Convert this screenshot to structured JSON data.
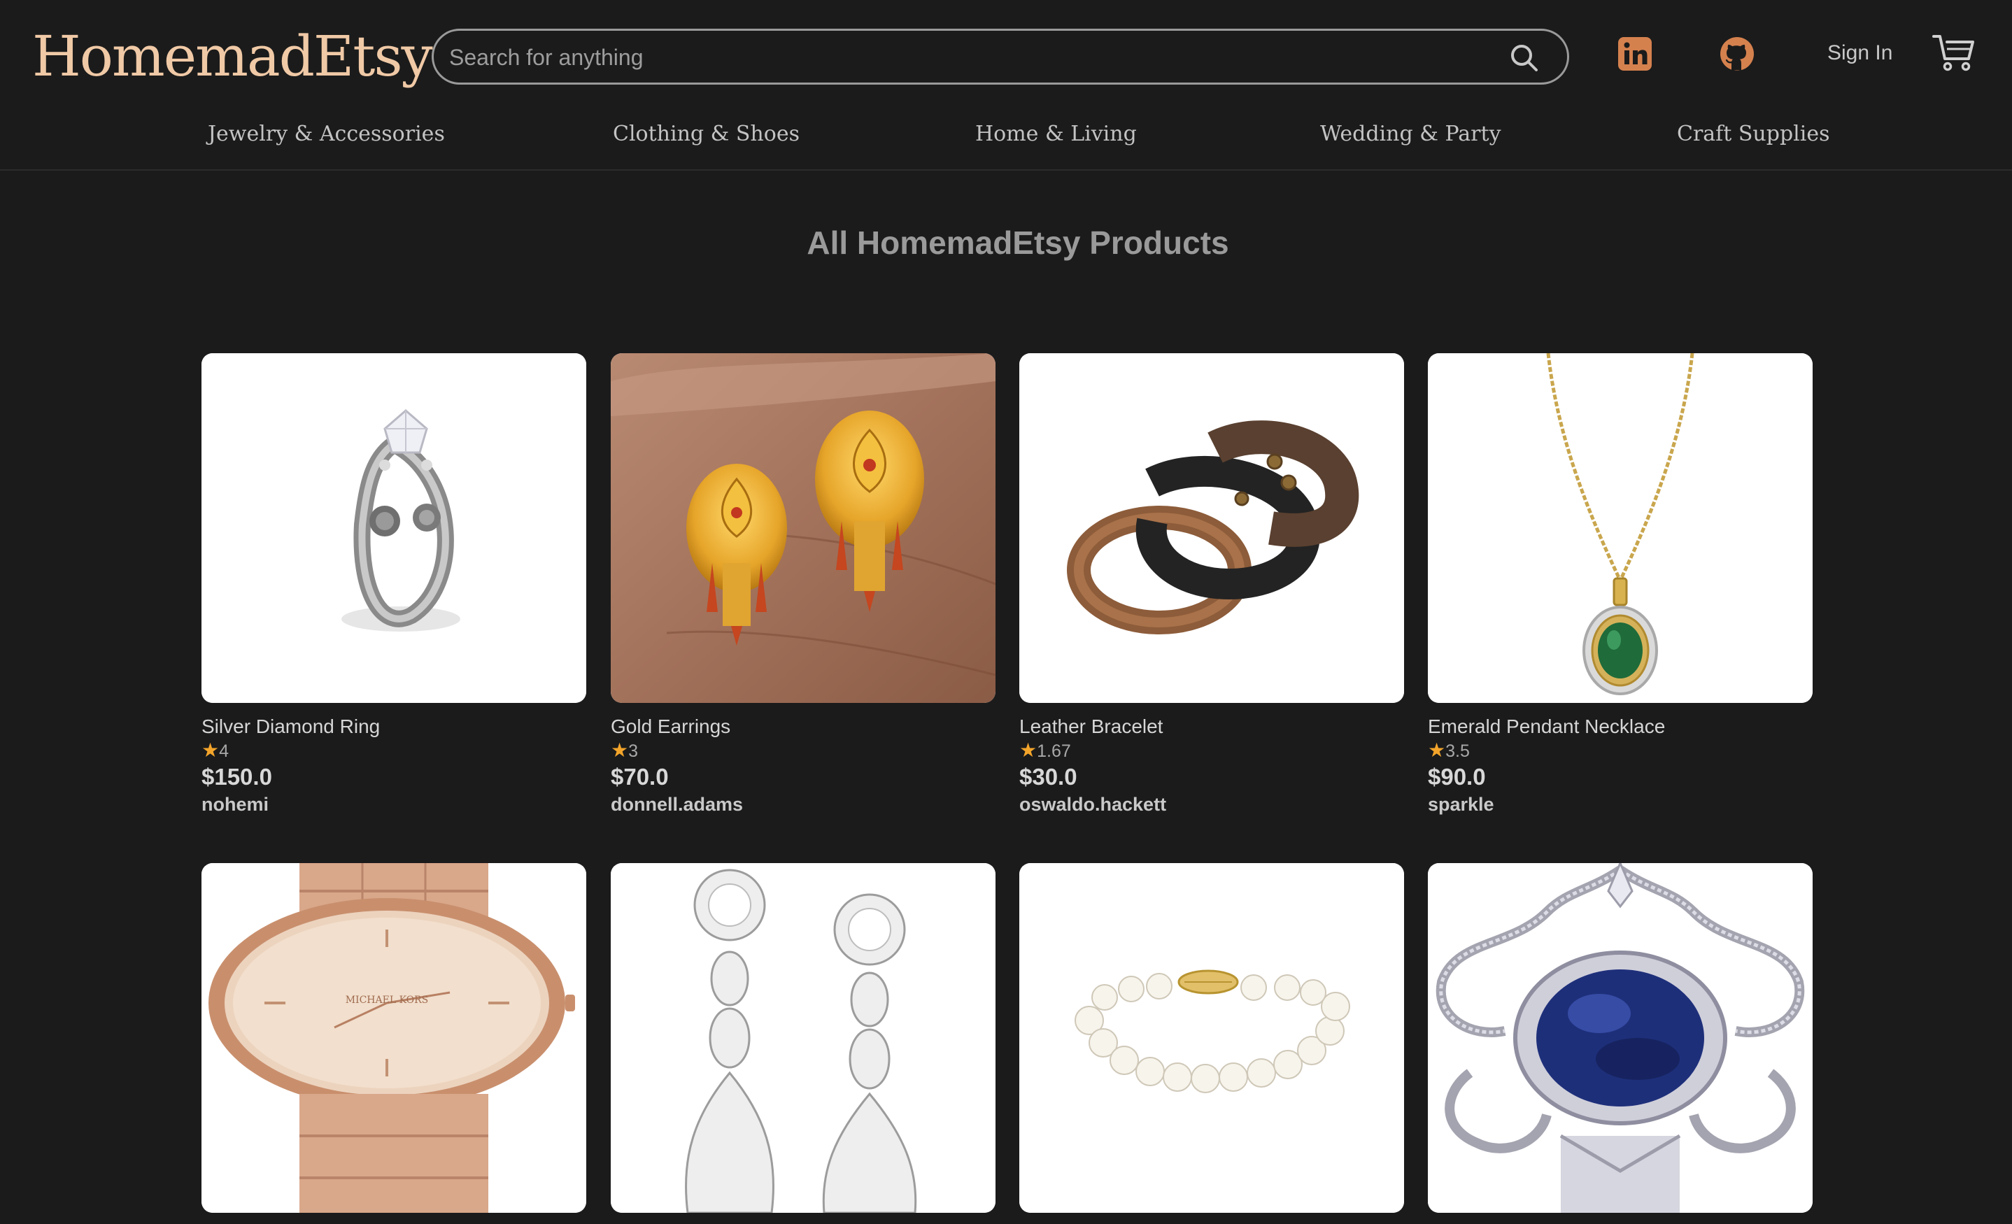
{
  "app": {
    "logo": "HomemadEtsy"
  },
  "header": {
    "search_placeholder": "Search for anything",
    "linkedin_icon": "linkedin-icon",
    "github_icon": "github-icon",
    "sign_in": "Sign In",
    "cart_icon": "cart-icon"
  },
  "categories": [
    "Jewelry & Accessories",
    "Clothing & Shoes",
    "Home & Living",
    "Wedding & Party",
    "Craft Supplies"
  ],
  "main": {
    "title": "All HomemadEtsy Products"
  },
  "products": [
    {
      "name": "Silver Diamond Ring",
      "rating": "4",
      "price": "$150.0",
      "seller": "nohemi"
    },
    {
      "name": "Gold Earrings",
      "rating": "3",
      "price": "$70.0",
      "seller": "donnell.adams"
    },
    {
      "name": "Leather Bracelet",
      "rating": "1.67",
      "price": "$30.0",
      "seller": "oswaldo.hackett"
    },
    {
      "name": "Emerald Pendant Necklace",
      "rating": "3.5",
      "price": "$90.0",
      "seller": "sparkle"
    },
    {
      "name": "",
      "rating": "",
      "price": "",
      "seller": ""
    },
    {
      "name": "",
      "rating": "",
      "price": "",
      "seller": ""
    },
    {
      "name": "",
      "rating": "",
      "price": "",
      "seller": ""
    },
    {
      "name": "",
      "rating": "",
      "price": "",
      "seller": ""
    }
  ],
  "colors": {
    "background": "#1b1b1b",
    "logo": "#f0c9a6",
    "social_icon": "#d5814e",
    "star": "#f3a52b"
  }
}
